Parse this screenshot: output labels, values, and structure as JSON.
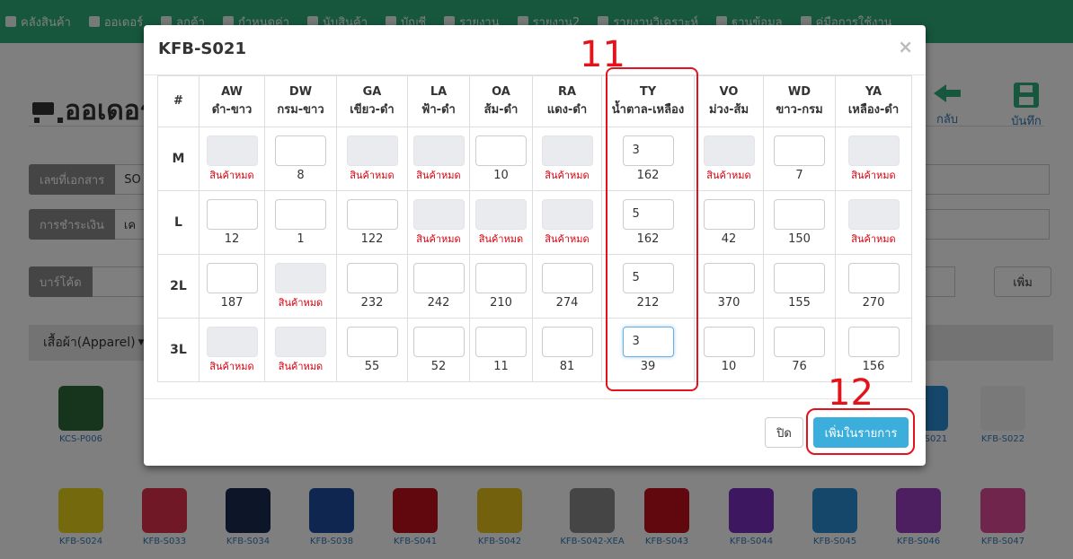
{
  "navbar": {
    "items": [
      "คลังสินค้า",
      "ออเดอร์",
      "ลูกค้า",
      "กำหนดค่า",
      "นับสินค้า",
      "บัญชี",
      "รายงาน",
      "รายงาน2",
      "รายงานวิเคราะห์",
      "ฐานข้อมูล",
      "คู่มือการใช้งาน"
    ]
  },
  "page": {
    "title": "ออเดอร์",
    "back_label": "กลับ",
    "save_label": "บันทึก",
    "doc_label": "เลขที่เอกสาร",
    "doc_value": "SO",
    "payment_label": "การชำระเงิน",
    "payment_value": "เค",
    "barcode_label": "บาร์โค้ด",
    "add_label": "เพิ่ม",
    "category_label": "เสื้อผ้า(Apparel)",
    "products": [
      "KCS-P006",
      "KFB-S021",
      "KFB-S022",
      "KFB-S024",
      "KFB-S033",
      "KFB-S034",
      "KFB-S038",
      "KFB-S041",
      "KFB-S042",
      "KFB-S042-XEA",
      "KFB-S043",
      "KFB-S044",
      "KFB-S045",
      "KFB-S046",
      "KFB-S047"
    ]
  },
  "modal": {
    "title": "KFB-S021",
    "close_symbol": "×",
    "hash_header": "#",
    "out_of_stock": "สินค้าหมด",
    "columns": [
      {
        "code": "AW",
        "name": "ดำ-ขาว"
      },
      {
        "code": "DW",
        "name": "กรม-ขาว"
      },
      {
        "code": "GA",
        "name": "เขียว-ดำ"
      },
      {
        "code": "LA",
        "name": "ฟ้า-ดำ"
      },
      {
        "code": "OA",
        "name": "ส้ม-ดำ"
      },
      {
        "code": "RA",
        "name": "แดง-ดำ"
      },
      {
        "code": "TY",
        "name": "น้ำตาล-เหลือง"
      },
      {
        "code": "VO",
        "name": "ม่วง-ส้ม"
      },
      {
        "code": "WD",
        "name": "ขาว-กรม"
      },
      {
        "code": "YA",
        "name": "เหลือง-ดำ"
      }
    ],
    "rows": [
      {
        "size": "M",
        "cells": [
          {
            "qty": "",
            "stock": null
          },
          {
            "qty": "",
            "stock": "8"
          },
          {
            "qty": "",
            "stock": null
          },
          {
            "qty": "",
            "stock": null
          },
          {
            "qty": "",
            "stock": "10"
          },
          {
            "qty": "",
            "stock": null
          },
          {
            "qty": "3",
            "stock": "162"
          },
          {
            "qty": "",
            "stock": null
          },
          {
            "qty": "",
            "stock": "7"
          },
          {
            "qty": "",
            "stock": null
          }
        ]
      },
      {
        "size": "L",
        "cells": [
          {
            "qty": "",
            "stock": "12"
          },
          {
            "qty": "",
            "stock": "1"
          },
          {
            "qty": "",
            "stock": "122"
          },
          {
            "qty": "",
            "stock": null
          },
          {
            "qty": "",
            "stock": null
          },
          {
            "qty": "",
            "stock": null
          },
          {
            "qty": "5",
            "stock": "162"
          },
          {
            "qty": "",
            "stock": "42"
          },
          {
            "qty": "",
            "stock": "150"
          },
          {
            "qty": "",
            "stock": null
          }
        ]
      },
      {
        "size": "2L",
        "cells": [
          {
            "qty": "",
            "stock": "187"
          },
          {
            "qty": "",
            "stock": null
          },
          {
            "qty": "",
            "stock": "232"
          },
          {
            "qty": "",
            "stock": "242"
          },
          {
            "qty": "",
            "stock": "210"
          },
          {
            "qty": "",
            "stock": "274"
          },
          {
            "qty": "5",
            "stock": "212"
          },
          {
            "qty": "",
            "stock": "370"
          },
          {
            "qty": "",
            "stock": "155"
          },
          {
            "qty": "",
            "stock": "270"
          }
        ]
      },
      {
        "size": "3L",
        "cells": [
          {
            "qty": "",
            "stock": null
          },
          {
            "qty": "",
            "stock": null
          },
          {
            "qty": "",
            "stock": "55"
          },
          {
            "qty": "",
            "stock": "52"
          },
          {
            "qty": "",
            "stock": "11"
          },
          {
            "qty": "",
            "stock": "81"
          },
          {
            "qty": "3",
            "stock": "39"
          },
          {
            "qty": "",
            "stock": "10"
          },
          {
            "qty": "",
            "stock": "76"
          },
          {
            "qty": "",
            "stock": "156"
          }
        ]
      }
    ],
    "close_label": "ปิด",
    "add_to_list_label": "เพิ่มในรายการ"
  },
  "annotations": {
    "column": "11",
    "button": "12"
  },
  "colors": {
    "navbar": "#2eaf7d",
    "primary_button": "#3caedb",
    "annotation": "#e3131b",
    "out_of_stock": "#d9000d"
  }
}
